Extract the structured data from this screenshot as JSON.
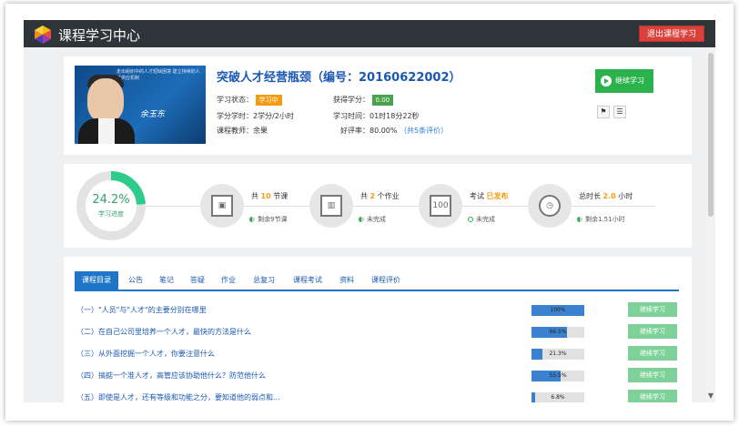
{
  "header": {
    "brand": "课程学习中心",
    "logout_label": "退出课程学习"
  },
  "course": {
    "title": "突破人才经营瓶颈（编号：20160622002）",
    "thumb_banner": "走出组织中的人才短缺困境 建立持续的人才供应机制",
    "thumb_signature": "余玉东",
    "status_label": "学习状态：",
    "status_value": "学习中",
    "credit_label": "获得学分：",
    "credit_value": "0.00",
    "hours_text": "学分学时：2学分/2小时",
    "time_text": "学习时间：01时18分22秒",
    "teacher_text": "课程教师：余果",
    "rating_text": "好评率：80.00%",
    "rating_link": "（共5条评价）",
    "continue_label": "继续学习"
  },
  "progress": {
    "percent": "24.2%",
    "percent_value": 24.2,
    "label": "学习进度",
    "stats": [
      {
        "prefix": "共 ",
        "num": "10",
        "suffix": " 节课",
        "glyph": "▣",
        "sub": "剩余9节课",
        "icon": "video-icon"
      },
      {
        "prefix": "共 ",
        "num": "2",
        "suffix": " 个作业",
        "glyph": "▥",
        "sub": "未完成",
        "icon": "book-icon"
      },
      {
        "prefix": "考试 ",
        "num": "已发布",
        "suffix": "",
        "glyph": "100",
        "sub": "未完成",
        "icon": "exam-icon"
      },
      {
        "prefix": "总时长 ",
        "num": "2.0",
        "suffix": " 小时",
        "glyph": "◷",
        "sub": "剩余1.51小时",
        "icon": "clock-icon"
      }
    ]
  },
  "tabs": [
    "课程目录",
    "公告",
    "笔记",
    "答疑",
    "作业",
    "总复习",
    "课程考试",
    "资料",
    "课程评价"
  ],
  "lessons": [
    {
      "title": "（一）\"人员\"与\"人才\"的主要分别在哪里",
      "progress": "100%",
      "value": 100,
      "action": "继续学习"
    },
    {
      "title": "（二）在自己公司里培养一个人才，最快的方法是什么",
      "progress": "66.5%",
      "value": 66.5,
      "action": "继续学习"
    },
    {
      "title": "（三）从外面挖掘一个人才，你要注意什么",
      "progress": "21.3%",
      "value": 21.3,
      "action": "继续学习"
    },
    {
      "title": "（四）搞掂一个准人才，高管应该协助他什么？防范他什么",
      "progress": "55.5%",
      "value": 55.5,
      "action": "继续学习"
    },
    {
      "title": "（五）即使是人才，还有等级和功能之分，要知道他的弱点和...",
      "progress": "6.8%",
      "value": 6.8,
      "action": "继续学习"
    }
  ],
  "colors": {
    "accent": "#1f76c8",
    "green": "#2bb24c",
    "orange": "#f39c12",
    "topbar": "#2f3439",
    "logout": "#d9413a"
  }
}
